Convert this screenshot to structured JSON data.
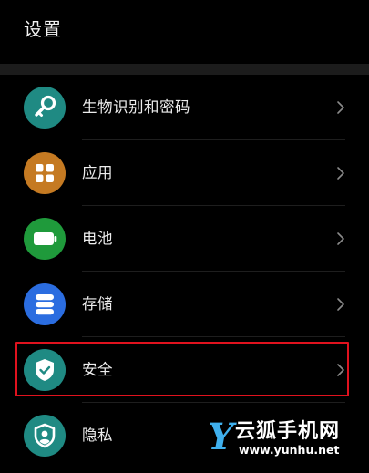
{
  "header": {
    "title": "设置"
  },
  "settings": [
    {
      "label": "生物识别和密码",
      "icon": "key-icon",
      "color": "#1f8a83"
    },
    {
      "label": "应用",
      "icon": "apps-grid-icon",
      "color": "#c57a22"
    },
    {
      "label": "电池",
      "icon": "battery-icon",
      "color": "#1f9a3b"
    },
    {
      "label": "存储",
      "icon": "storage-icon",
      "color": "#2b6de0"
    },
    {
      "label": "安全",
      "icon": "shield-check-icon",
      "color": "#1f8a83",
      "highlighted": true
    },
    {
      "label": "隐私",
      "icon": "privacy-icon",
      "color": "#1f8a83"
    }
  ],
  "watermark": {
    "letter": "Y",
    "title": "云狐手机网",
    "url": "www.yunhu.net"
  },
  "colors": {
    "background": "#000000",
    "highlight": "#e0121e",
    "chevron": "#8a8a8a"
  }
}
